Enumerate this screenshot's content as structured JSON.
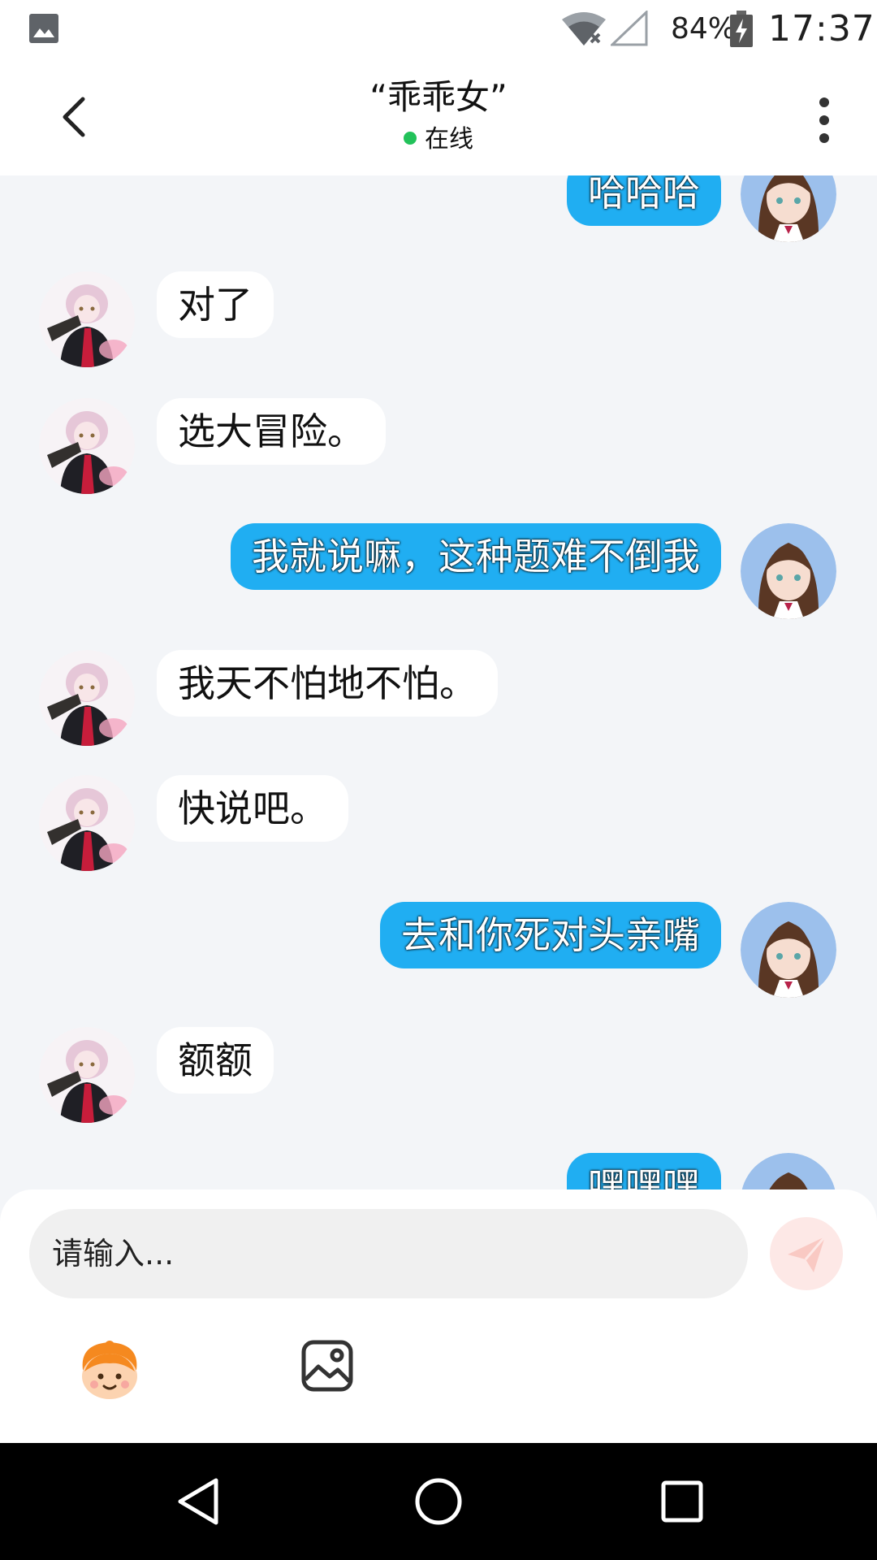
{
  "status_bar": {
    "battery_percent": "84%",
    "time": "17:37",
    "icons": [
      "gallery-icon",
      "wifi-off-icon",
      "signal-icon",
      "battery-charging-icon"
    ]
  },
  "header": {
    "title": "“乖乖女”",
    "status": "在线",
    "status_color": "#22c25a"
  },
  "messages": [
    {
      "side": "out",
      "text": "哈哈哈",
      "avatar": "girl-avatar"
    },
    {
      "side": "in",
      "text": "对了",
      "avatar": "anime-avatar"
    },
    {
      "side": "in",
      "text": "选大冒险。",
      "avatar": "anime-avatar"
    },
    {
      "side": "out",
      "text": "我就说嘛，这种题难不倒我",
      "avatar": "girl-avatar"
    },
    {
      "side": "in",
      "text": "我天不怕地不怕。",
      "avatar": "anime-avatar"
    },
    {
      "side": "in",
      "text": "快说吧。",
      "avatar": "anime-avatar"
    },
    {
      "side": "out",
      "text": "去和你死对头亲嘴",
      "avatar": "girl-avatar"
    },
    {
      "side": "in",
      "text": "额额",
      "avatar": "anime-avatar"
    },
    {
      "side": "out",
      "text": "嘿嘿嘿",
      "avatar": "girl-avatar"
    }
  ],
  "input": {
    "placeholder": "请输入..."
  },
  "colors": {
    "outgoing_bubble": "#20aef2",
    "incoming_bubble": "#ffffff",
    "send_button": "#fde8e6"
  }
}
